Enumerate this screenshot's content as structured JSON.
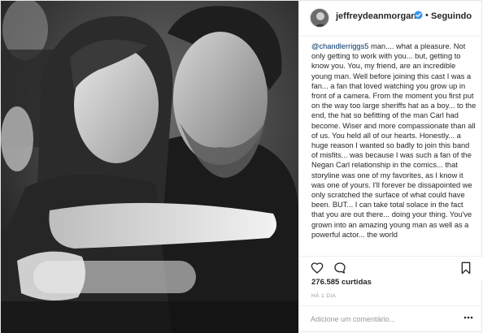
{
  "post": {
    "image_alt": "",
    "author": {
      "username": "jeffreydeanmorgan",
      "verified": true,
      "follow_separator": "•",
      "follow_label": "Seguindo"
    },
    "caption": {
      "mention": "@chandlerriggs5",
      "text": " man.... what a pleasure. Not only getting to work with you... but, getting to know you. You, my friend, are an incredible young man. Well before joining this cast I was a fan... a fan that loved watching you grow up in front of a camera. From the moment you first put on the way too large sheriffs hat as a boy... to the end, the hat so befitting of the man Carl had become. Wiser and more compassionate than all of us. You held all of our hearts. Honestly... a huge reason I wanted so badly to join this band of misfits... was because I was such a fan of the Negan Carl relationship in the comics... that storyline was one of my favorites, as I know it was one of yours. I'll forever be dissapointed we only scratched the surface of what could have been. BUT... I can take total solace in the fact that you are out there... doing your thing. You've grown into an amazing young man as well as a powerful actor... the world"
    },
    "actions": {
      "like_icon": "heart-icon",
      "comment_icon": "comment-icon",
      "bookmark_icon": "bookmark-icon"
    },
    "likes_text": "276.585 curtidas",
    "timestamp": "HÁ 1 DIA",
    "comment": {
      "placeholder": "Adicione um comentário...",
      "value": "",
      "more_icon": "more-options-icon"
    }
  },
  "colors": {
    "text": "#262626",
    "mention": "#003569",
    "muted": "#999999",
    "border": "#efefef",
    "verified": "#3897f0"
  }
}
